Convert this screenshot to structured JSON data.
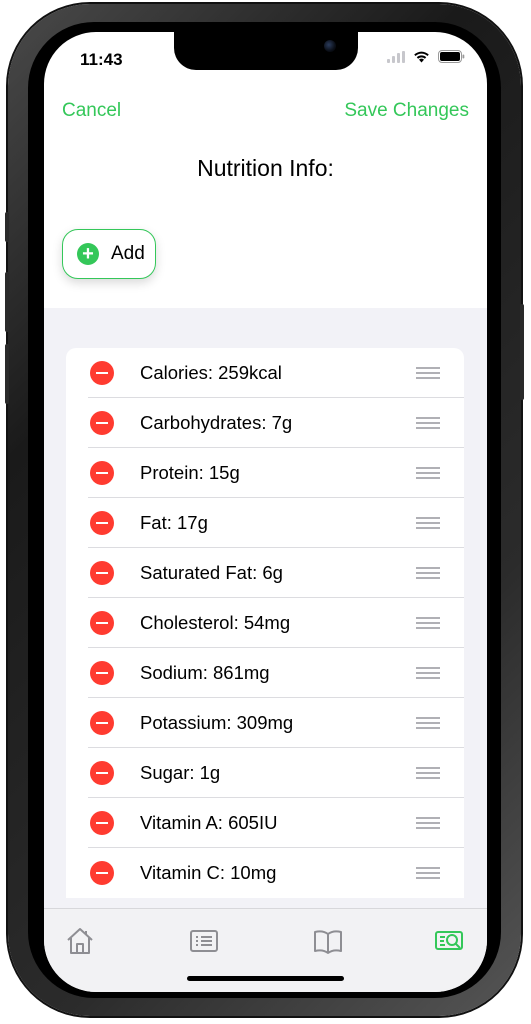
{
  "status_bar": {
    "time": "11:43"
  },
  "nav": {
    "cancel_label": "Cancel",
    "save_label": "Save Changes"
  },
  "title": "Nutrition Info:",
  "add_button": {
    "label": "Add",
    "icon": "plus-circle-icon"
  },
  "nutrition_items": [
    {
      "label": "Calories: 259kcal"
    },
    {
      "label": "Carbohydrates: 7g"
    },
    {
      "label": "Protein: 15g"
    },
    {
      "label": "Fat: 17g"
    },
    {
      "label": "Saturated Fat: 6g"
    },
    {
      "label": "Cholesterol: 54mg"
    },
    {
      "label": "Sodium: 861mg"
    },
    {
      "label": "Potassium: 309mg"
    },
    {
      "label": "Sugar: 1g"
    },
    {
      "label": "Vitamin A: 605IU"
    },
    {
      "label": "Vitamin C: 10mg"
    }
  ],
  "tabs": [
    {
      "icon": "home-icon",
      "active": false
    },
    {
      "icon": "list-icon",
      "active": false
    },
    {
      "icon": "book-icon",
      "active": false
    },
    {
      "icon": "search-recipe-icon",
      "active": true
    }
  ],
  "colors": {
    "accent": "#34c759",
    "delete": "#ff3b30",
    "inactive_icon": "#8e8e93",
    "list_background": "#f2f2f7"
  }
}
